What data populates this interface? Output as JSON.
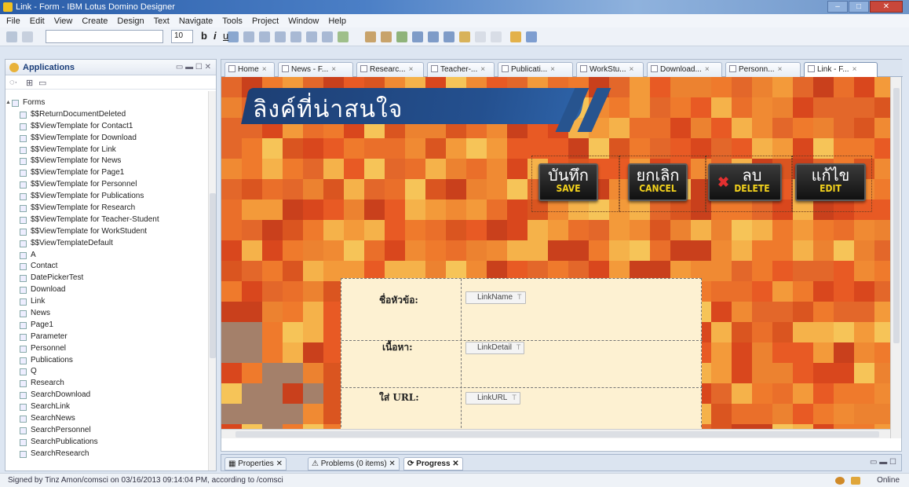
{
  "window": {
    "title": "Link - Form - IBM Lotus Domino Designer",
    "controls": [
      "–",
      "□",
      "✕"
    ]
  },
  "menubar": {
    "items": [
      "File",
      "Edit",
      "View",
      "Create",
      "Design",
      "Text",
      "Navigate",
      "Tools",
      "Project",
      "Window",
      "Help"
    ]
  },
  "toolbar": {
    "font_size": "10",
    "bold_label": "b",
    "italic_label": "i",
    "underline_label": "u"
  },
  "left_panel": {
    "title": "Applications",
    "tree": [
      {
        "label": "Forms",
        "expanded": true
      },
      {
        "label": "$$ReturnDocumentDeleted"
      },
      {
        "label": "$$ViewTemplate for Contact1"
      },
      {
        "label": "$$ViewTemplate for Download"
      },
      {
        "label": "$$ViewTemplate for Link"
      },
      {
        "label": "$$ViewTemplate for News"
      },
      {
        "label": "$$ViewTemplate for Page1"
      },
      {
        "label": "$$ViewTemplate for Personnel"
      },
      {
        "label": "$$ViewTemplate for Publications"
      },
      {
        "label": "$$ViewTemplate for Research"
      },
      {
        "label": "$$ViewTemplate for Teacher-Student"
      },
      {
        "label": "$$ViewTemplate for WorkStudent"
      },
      {
        "label": "$$ViewTemplateDefault"
      },
      {
        "label": "A"
      },
      {
        "label": "Contact"
      },
      {
        "label": "DatePickerTest"
      },
      {
        "label": "Download"
      },
      {
        "label": "Link"
      },
      {
        "label": "News"
      },
      {
        "label": "Page1"
      },
      {
        "label": "Parameter"
      },
      {
        "label": "Personnel"
      },
      {
        "label": "Publications"
      },
      {
        "label": "Q"
      },
      {
        "label": "Research"
      },
      {
        "label": "SearchDownload"
      },
      {
        "label": "SearchLink"
      },
      {
        "label": "SearchNews"
      },
      {
        "label": "SearchPersonnel"
      },
      {
        "label": "SearchPublications"
      },
      {
        "label": "SearchResearch"
      }
    ]
  },
  "editor": {
    "tabs": [
      {
        "label": "Home"
      },
      {
        "label": "News - F..."
      },
      {
        "label": "Researc..."
      },
      {
        "label": "Teacher-..."
      },
      {
        "label": "Publicati..."
      },
      {
        "label": "WorkStu..."
      },
      {
        "label": "Download..."
      },
      {
        "label": "Personn..."
      },
      {
        "label": "Link - F...",
        "active": true
      }
    ],
    "banner_title": "ลิงค์ที่น่าสนใจ",
    "buttons": [
      {
        "th": "บันทึก",
        "en": "SAVE"
      },
      {
        "th": "ยกเลิก",
        "en": "CANCEL"
      },
      {
        "th": "ลบ",
        "en": "DELETE"
      },
      {
        "th": "แก้ไข",
        "en": "EDIT"
      }
    ],
    "form_rows": [
      {
        "label": "ชื่อหัวข้อ:",
        "field": "LinkName",
        "type_mark": "T"
      },
      {
        "label": "เนื้อหา:",
        "field": "LinkDetail",
        "type_mark": "T"
      },
      {
        "label": "ใส่ URL:",
        "field": "LinkURL",
        "type_mark": "T"
      }
    ]
  },
  "bottom_panel": {
    "tabs": [
      {
        "label": "Properties"
      },
      {
        "label": "Problems (0 items)"
      },
      {
        "label": "Progress",
        "active": true
      }
    ]
  },
  "statusbar": {
    "text": "Signed by Tinz Amon/comsci on 03/16/2013 09:14:04 PM, according to /comsci",
    "online": "Online"
  },
  "colors": {
    "banner": "#24508f",
    "button_en_text": "#f3d21c",
    "form_bg": "#fdf1d2",
    "canvas_bg": "#e8642b"
  }
}
